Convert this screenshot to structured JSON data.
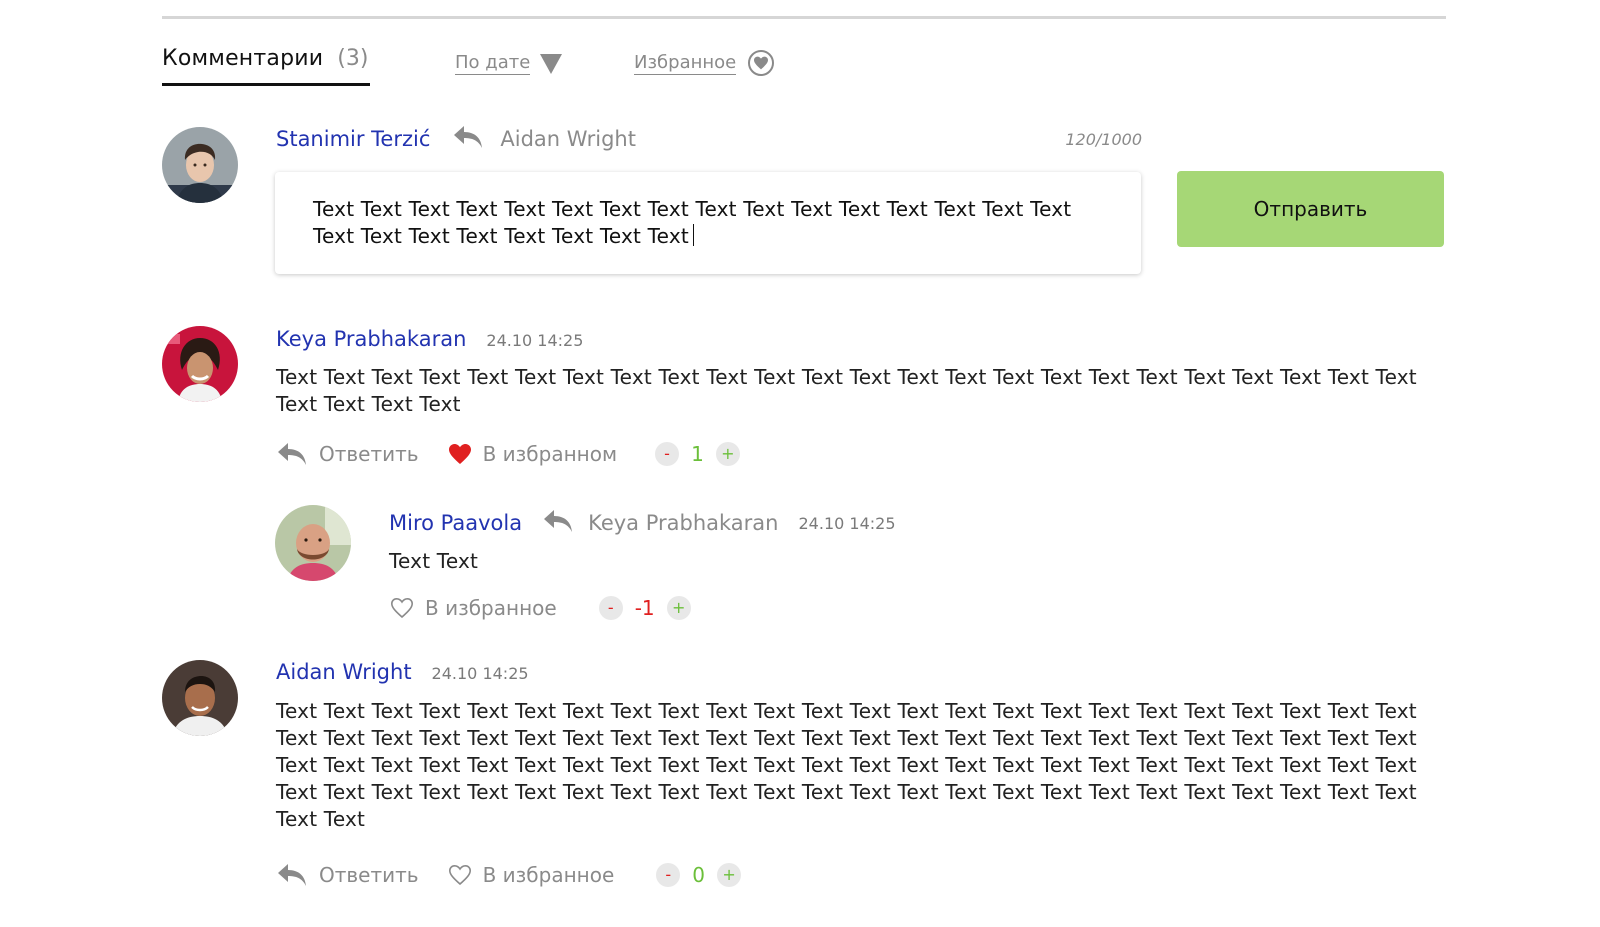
{
  "tabs": {
    "comments_label": "Комментарии",
    "comments_count": "(3)",
    "sort_label": "По дате",
    "favorites_label": "Избранное"
  },
  "composer": {
    "author": "Stanimir Terzić",
    "reply_to": "Aidan Wright",
    "counter": "120/1000",
    "text": "Text Text Text Text Text Text Text Text Text Text Text Text Text Text Text Text Text Text Text Text Text Text Text Text",
    "send_label": "Отправить"
  },
  "comments": [
    {
      "author": "Keya Prabhakaran",
      "time": "24.10 14:25",
      "text": "Text Text Text Text Text Text Text Text Text Text Text Text Text Text Text Text Text Text Text Text Text Text Text Text Text Text Text Text",
      "reply_label": "Ответить",
      "fav_label": "В избранном",
      "fav_active": true,
      "votes": "1"
    },
    {
      "author": "Miro Paavola",
      "reply_to": "Keya Prabhakaran",
      "time": "24.10 14:25",
      "text": "Text Text",
      "fav_label": "В избранное",
      "fav_active": false,
      "votes": "-1"
    },
    {
      "author": "Aidan Wright",
      "time": "24.10 14:25",
      "text": "Text Text Text Text Text Text Text Text Text Text Text Text Text Text Text Text Text Text Text Text Text Text Text Text Text Text Text Text Text Text Text Text Text Text Text Text Text Text Text Text Text Text Text Text Text Text Text Text Text Text Text Text Text Text Text Text Text Text Text Text Text Text Text Text Text Text Text Text Text Text Text Text Text Text Text Text Text Text Text Text Text Text Text Text Text Text Text Text Text Text Text Text Text Text Text Text Text Text",
      "reply_label": "Ответить",
      "fav_label": "В избранное",
      "fav_active": false,
      "votes": "0"
    }
  ],
  "vote_minus": "-",
  "vote_plus": "+",
  "colors": {
    "accent_name": "#2233b0",
    "send_button": "#a6d776",
    "heart_active": "#e02020",
    "vote_positive": "#6bbf3a",
    "vote_negative": "#e02020"
  }
}
